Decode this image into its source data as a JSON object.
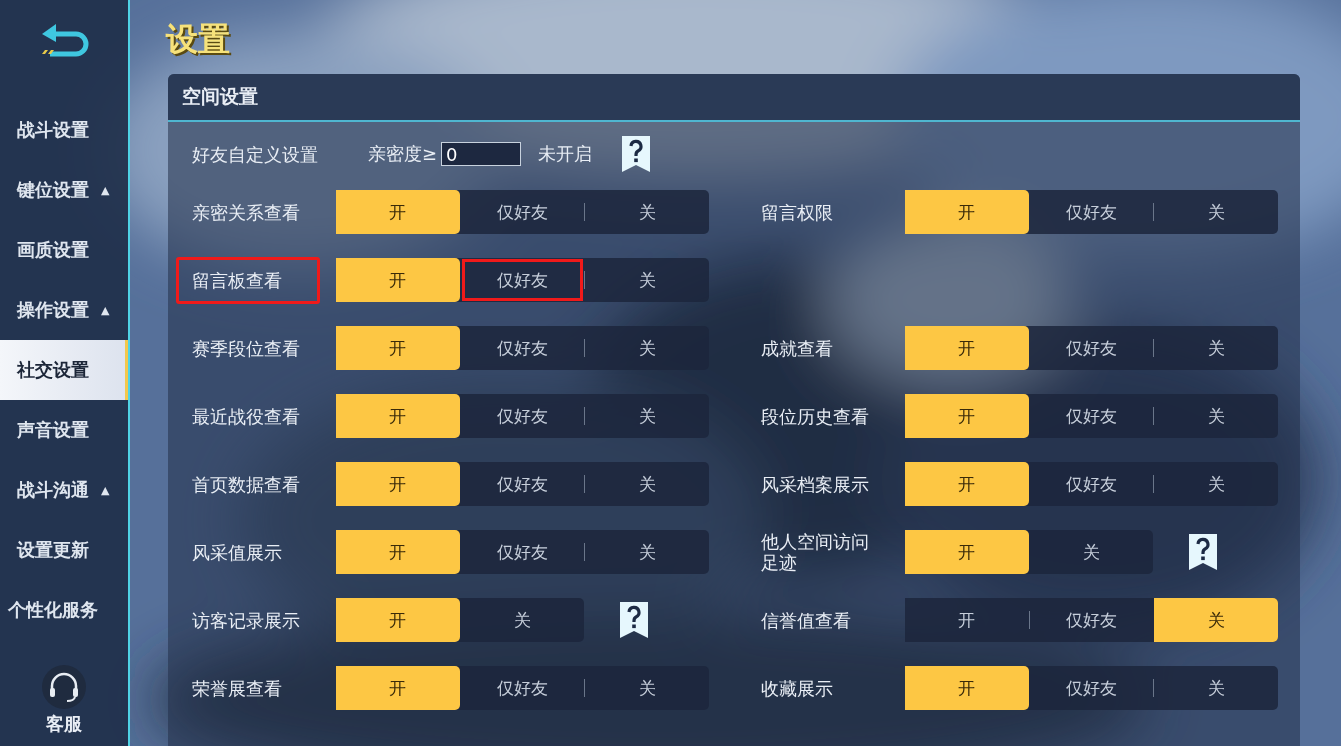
{
  "sidebar": {
    "items": [
      {
        "label": "战斗设置",
        "selected": false
      },
      {
        "label": "键位设置",
        "selected": false,
        "caret": "▲"
      },
      {
        "label": "画质设置",
        "selected": false
      },
      {
        "label": "操作设置",
        "selected": false,
        "caret": "▲"
      },
      {
        "label": "社交设置",
        "selected": true
      },
      {
        "label": "声音设置",
        "selected": false
      },
      {
        "label": "战斗沟通",
        "selected": false,
        "caret": "▲"
      },
      {
        "label": "设置更新",
        "selected": false
      },
      {
        "label": "个性化服务",
        "selected": false
      }
    ],
    "support": {
      "label": "客服"
    }
  },
  "page_title": "设置",
  "panel": {
    "title": "空间设置",
    "friend_custom": {
      "label": "好友自定义设置",
      "intimacy_label": "亲密度≥",
      "intimacy_value": "0",
      "status": "未开启"
    },
    "rows": [
      {
        "left": {
          "label": "亲密关系查看",
          "marked": false,
          "help": false,
          "options": [
            {
              "label": "开",
              "selected": true,
              "marked": false
            },
            {
              "label": "仅好友",
              "selected": false,
              "marked": false
            },
            {
              "label": "关",
              "selected": false,
              "marked": false
            }
          ]
        },
        "right": {
          "label": "留言权限",
          "marked": false,
          "help": false,
          "options": [
            {
              "label": "开",
              "selected": true,
              "marked": false
            },
            {
              "label": "仅好友",
              "selected": false,
              "marked": false
            },
            {
              "label": "关",
              "selected": false,
              "marked": false
            }
          ]
        }
      },
      {
        "left": {
          "label": "留言板查看",
          "marked": true,
          "help": false,
          "options": [
            {
              "label": "开",
              "selected": true,
              "marked": false
            },
            {
              "label": "仅好友",
              "selected": false,
              "marked": true
            },
            {
              "label": "关",
              "selected": false,
              "marked": false
            }
          ]
        }
      },
      {
        "left": {
          "label": "赛季段位查看",
          "marked": false,
          "help": false,
          "options": [
            {
              "label": "开",
              "selected": true,
              "marked": false
            },
            {
              "label": "仅好友",
              "selected": false,
              "marked": false
            },
            {
              "label": "关",
              "selected": false,
              "marked": false
            }
          ]
        },
        "right": {
          "label": "成就查看",
          "marked": false,
          "help": false,
          "options": [
            {
              "label": "开",
              "selected": true,
              "marked": false
            },
            {
              "label": "仅好友",
              "selected": false,
              "marked": false
            },
            {
              "label": "关",
              "selected": false,
              "marked": false
            }
          ]
        }
      },
      {
        "left": {
          "label": "最近战役查看",
          "marked": false,
          "help": false,
          "options": [
            {
              "label": "开",
              "selected": true,
              "marked": false
            },
            {
              "label": "仅好友",
              "selected": false,
              "marked": false
            },
            {
              "label": "关",
              "selected": false,
              "marked": false
            }
          ]
        },
        "right": {
          "label": "段位历史查看",
          "marked": false,
          "help": false,
          "options": [
            {
              "label": "开",
              "selected": true,
              "marked": false
            },
            {
              "label": "仅好友",
              "selected": false,
              "marked": false
            },
            {
              "label": "关",
              "selected": false,
              "marked": false
            }
          ]
        }
      },
      {
        "left": {
          "label": "首页数据查看",
          "marked": false,
          "help": false,
          "options": [
            {
              "label": "开",
              "selected": true,
              "marked": false
            },
            {
              "label": "仅好友",
              "selected": false,
              "marked": false
            },
            {
              "label": "关",
              "selected": false,
              "marked": false
            }
          ]
        },
        "right": {
          "label": "风采档案展示",
          "marked": false,
          "help": false,
          "options": [
            {
              "label": "开",
              "selected": true,
              "marked": false
            },
            {
              "label": "仅好友",
              "selected": false,
              "marked": false
            },
            {
              "label": "关",
              "selected": false,
              "marked": false
            }
          ]
        }
      },
      {
        "left": {
          "label": "风采值展示",
          "marked": false,
          "help": false,
          "options": [
            {
              "label": "开",
              "selected": true,
              "marked": false
            },
            {
              "label": "仅好友",
              "selected": false,
              "marked": false
            },
            {
              "label": "关",
              "selected": false,
              "marked": false
            }
          ]
        },
        "right": {
          "label": "他人空间访问足迹",
          "marked": false,
          "help": true,
          "options": [
            {
              "label": "开",
              "selected": true,
              "marked": false
            },
            {
              "label": "关",
              "selected": false,
              "marked": false
            }
          ]
        }
      },
      {
        "left": {
          "label": "访客记录展示",
          "marked": false,
          "help": true,
          "options": [
            {
              "label": "开",
              "selected": true,
              "marked": false
            },
            {
              "label": "关",
              "selected": false,
              "marked": false
            }
          ]
        },
        "right": {
          "label": "信誉值查看",
          "marked": false,
          "help": false,
          "options": [
            {
              "label": "开",
              "selected": false,
              "marked": false
            },
            {
              "label": "仅好友",
              "selected": false,
              "marked": false
            },
            {
              "label": "关",
              "selected": true,
              "marked": false
            }
          ]
        }
      },
      {
        "left": {
          "label": "荣誉展查看",
          "marked": false,
          "help": false,
          "options": [
            {
              "label": "开",
              "selected": true,
              "marked": false
            },
            {
              "label": "仅好友",
              "selected": false,
              "marked": false
            },
            {
              "label": "关",
              "selected": false,
              "marked": false
            }
          ]
        },
        "right": {
          "label": "收藏展示",
          "marked": false,
          "help": false,
          "options": [
            {
              "label": "开",
              "selected": true,
              "marked": false
            },
            {
              "label": "仅好友",
              "selected": false,
              "marked": false
            },
            {
              "label": "关",
              "selected": false,
              "marked": false
            }
          ]
        }
      }
    ]
  }
}
